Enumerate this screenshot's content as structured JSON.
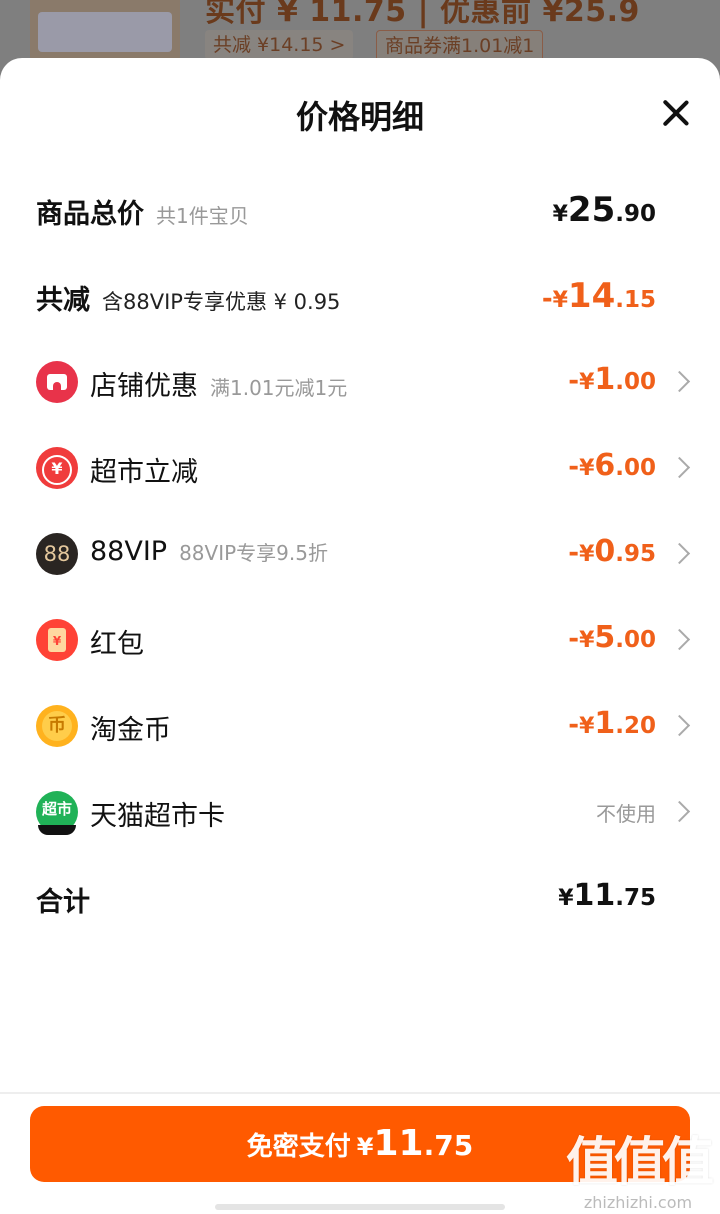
{
  "background": {
    "price_text": "实付 ¥ 11.75 | 优惠前 ¥25.9",
    "tag_total_discount": "共减 ¥14.15 >",
    "tag_coupon": "商品券满1.01减1"
  },
  "sheet": {
    "title": "价格明细",
    "close_icon": "close-icon"
  },
  "rows": {
    "total": {
      "label": "商品总价",
      "sub": "共1件宝贝",
      "currency": "¥",
      "int": "25",
      "dec": ".90"
    },
    "reduction": {
      "label": "共减",
      "sub": "含88VIP专享优惠 ¥ 0.95",
      "dash": "-",
      "currency": "¥",
      "int": "14",
      "dec": ".15"
    },
    "shop": {
      "label": "店铺优惠",
      "sub": "满1.01元减1元",
      "dash": "-",
      "currency": "¥",
      "int": "1",
      "dec": ".00",
      "icon": "shop-icon"
    },
    "market": {
      "label": "超市立减",
      "dash": "-",
      "currency": "¥",
      "int": "6",
      "dec": ".00",
      "icon": "yuan-icon"
    },
    "vip": {
      "label": "88VIP",
      "sub": "88VIP专享9.5折",
      "dash": "-",
      "currency": "¥",
      "int": "0",
      "dec": ".95",
      "icon_text": "88"
    },
    "hongbao": {
      "label": "红包",
      "dash": "-",
      "currency": "¥",
      "int": "5",
      "dec": ".00",
      "icon": "red-envelope-icon"
    },
    "coin": {
      "label": "淘金币",
      "dash": "-",
      "currency": "¥",
      "int": "1",
      "dec": ".20",
      "icon": "coin-icon"
    },
    "card": {
      "label": "天猫超市卡",
      "value": "不使用",
      "icon_text": "超市"
    },
    "sum": {
      "label": "合计",
      "currency": "¥",
      "int": "11",
      "dec": ".75"
    }
  },
  "pay_button": {
    "label": "免密支付",
    "currency": "¥",
    "int": "11",
    "dec": ".75"
  },
  "watermark": {
    "big": "值值值",
    "small": "zhizhizhi.com"
  },
  "colors": {
    "accent": "#ff5a00",
    "discount": "#f0601a"
  }
}
